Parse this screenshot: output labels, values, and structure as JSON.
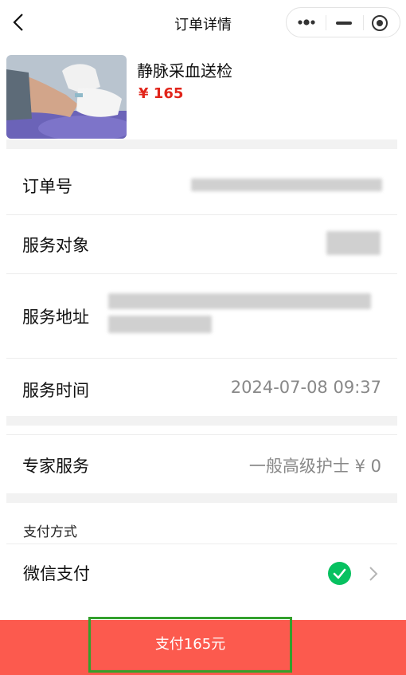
{
  "nav": {
    "title": "订单详情",
    "back_icon": "chevron-left-icon",
    "more_icon": "more-dots-icon",
    "minimize_icon": "minimize-icon",
    "close_icon": "target-close-icon"
  },
  "product": {
    "name": "静脉采血送检",
    "price": "¥ 165",
    "image": "blood-draw-photo"
  },
  "details": {
    "order_no_label": "订单号",
    "service_target_label": "服务对象",
    "service_address_label": "服务地址",
    "service_time_label": "服务时间",
    "service_time_value": "2024-07-08 09:37"
  },
  "expert": {
    "label": "专家服务",
    "value": "一般高级护士 ¥ 0"
  },
  "payment": {
    "section_label": "支付方式",
    "method_label": "微信支付",
    "selected": true,
    "pay_button": "支付165元"
  },
  "colors": {
    "price_red": "#e1251b",
    "pay_bar": "#fc5a4e",
    "check_green": "#07c160",
    "highlight_border": "#33a02c"
  }
}
